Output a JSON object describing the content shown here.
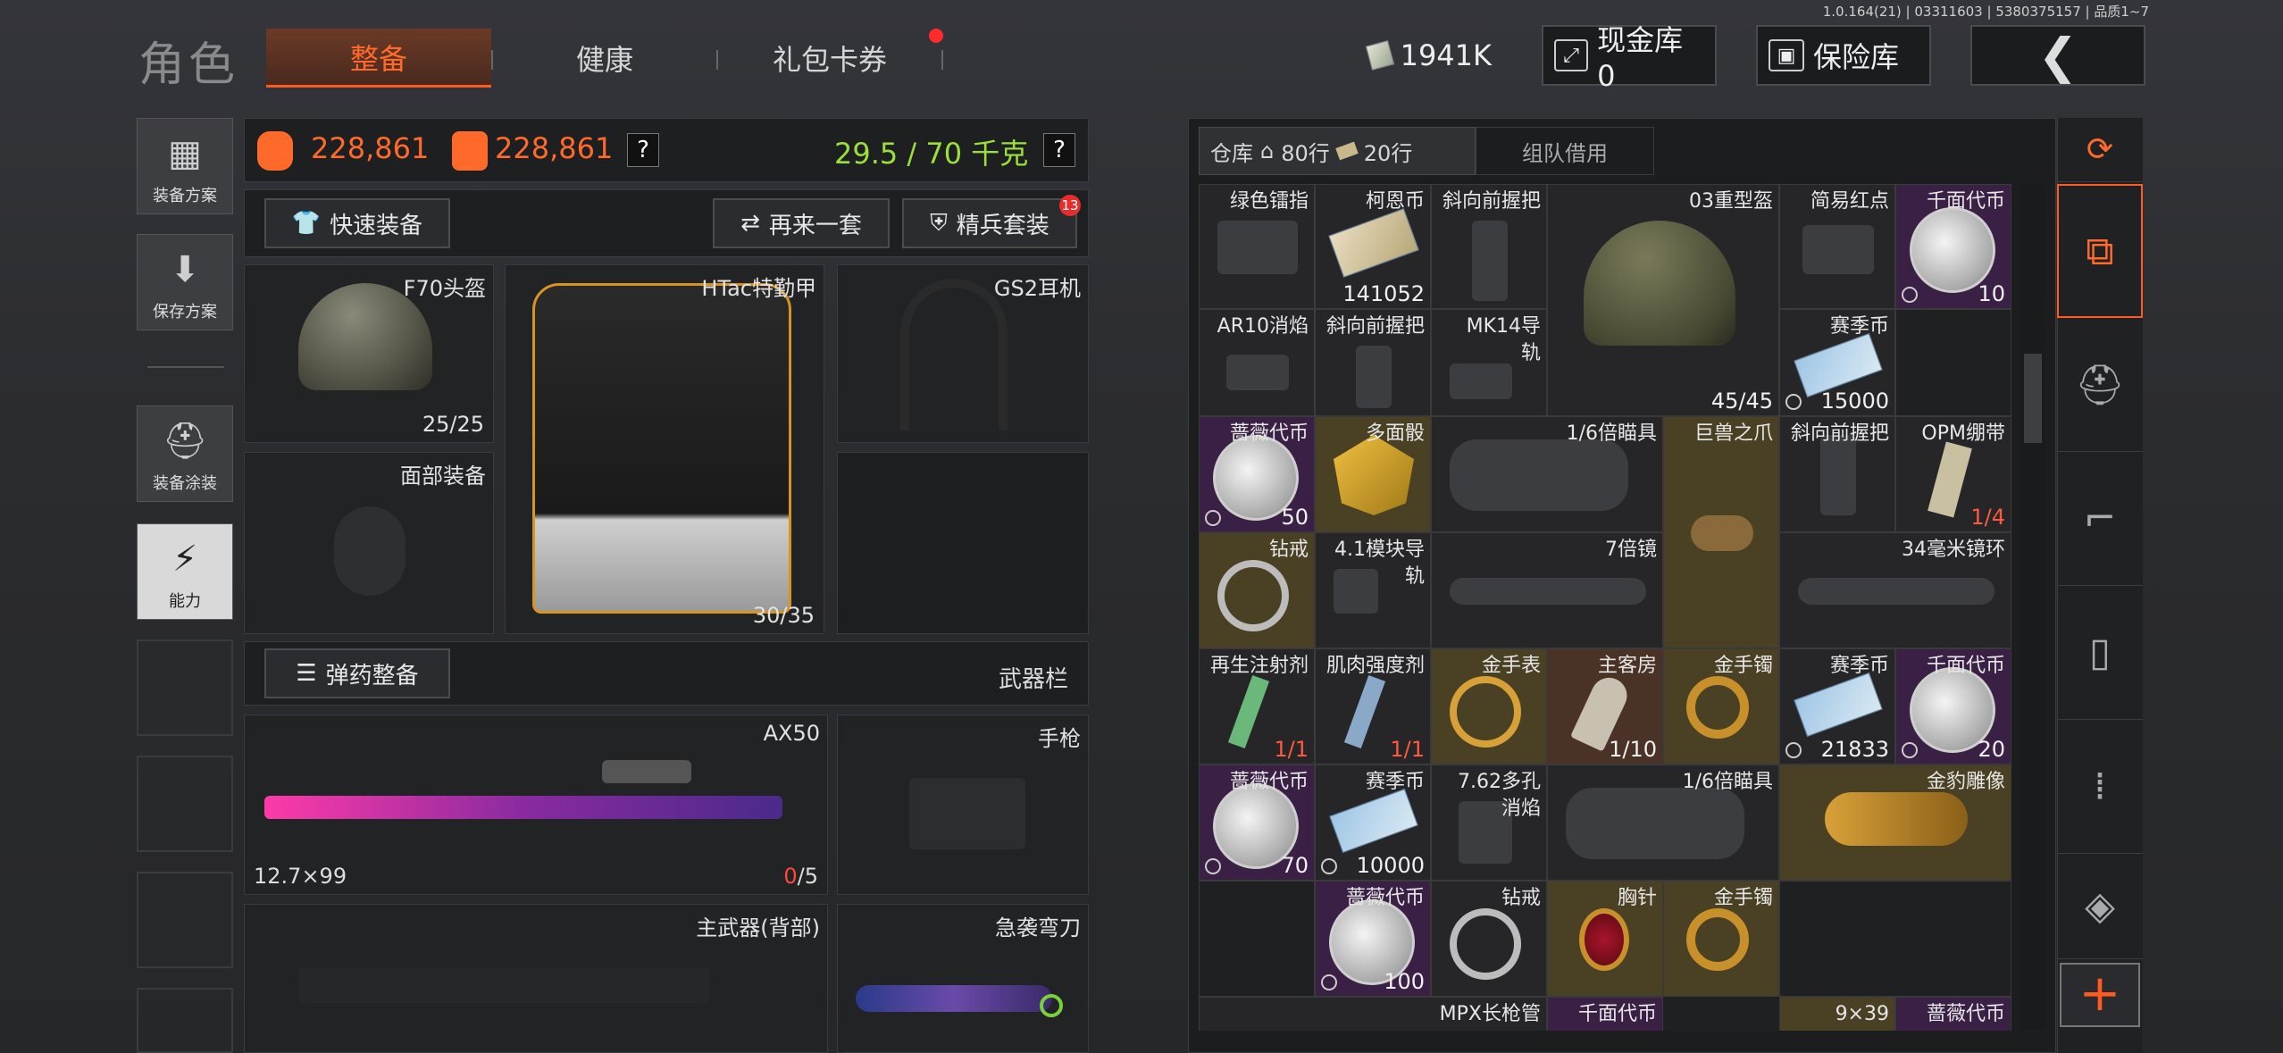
{
  "version": "1.0.164(21) | 03311603 | 5380375157 | 品质1~7",
  "header": {
    "title": "角色",
    "tabs": [
      {
        "label": "整备",
        "active": true
      },
      {
        "label": "健康",
        "active": false
      },
      {
        "label": "礼包卡券",
        "active": false,
        "dot": true
      }
    ],
    "money": "1941K",
    "cash_vault": "现金库 0",
    "safe_box": "保险库"
  },
  "sidebar": [
    {
      "label": "装备方案",
      "icon": "vest-plan-icon"
    },
    {
      "label": "保存方案",
      "icon": "download-icon"
    },
    {
      "label": "装备涂装",
      "icon": "helmet-skin-icon"
    },
    {
      "label": "能力",
      "icon": "ability-icon",
      "selected": true
    }
  ],
  "stats": {
    "value1": "228,861",
    "value2": "228,861",
    "weight": "29.5 / 70 千克",
    "help": "?"
  },
  "actions": {
    "quick_equip": "快速装备",
    "again": "再来一套",
    "elite": "精兵套装",
    "elite_badge": "13",
    "ammo": "弹药整备",
    "weapon_bar": "武器栏"
  },
  "slots": {
    "helmet": {
      "name": "F70头盔",
      "count": "25/25"
    },
    "armor": {
      "name": "HTac特勤甲",
      "count": "30/35"
    },
    "headset": {
      "name": "GS2耳机"
    },
    "face": {
      "name": "面部装备"
    },
    "rifle": {
      "name": "AX50",
      "caliber": "12.7×99",
      "ammo_loaded": "0",
      "ammo_total": "/5"
    },
    "pistol": {
      "name": "手枪"
    },
    "back": {
      "name": "主武器(背部)"
    },
    "melee": {
      "name": "急袭弯刀"
    }
  },
  "storage": {
    "tab_label": "仓库",
    "rows_label": "80行",
    "rows2_label": "20行",
    "team_borrow": "组队借用",
    "items": [
      {
        "name": "绿色镭指",
        "qty": ""
      },
      {
        "name": "柯恩币",
        "qty": "141052"
      },
      {
        "name": "斜向前握把",
        "qty": ""
      },
      {
        "name": "03重型盔",
        "qty": "45/45"
      },
      {
        "name": "简易红点",
        "qty": ""
      },
      {
        "name": "千面代币",
        "qty": "10"
      },
      {
        "name": "AR10消焰",
        "qty": ""
      },
      {
        "name": "斜向前握把",
        "qty": ""
      },
      {
        "name": "MK14导轨",
        "qty": ""
      },
      {
        "name": "赛季币",
        "qty": "15000"
      },
      {
        "name": "蔷薇代币",
        "qty": "50"
      },
      {
        "name": "多面骰",
        "qty": ""
      },
      {
        "name": "1/6倍瞄具",
        "qty": ""
      },
      {
        "name": "巨兽之爪",
        "qty": ""
      },
      {
        "name": "斜向前握把",
        "qty": ""
      },
      {
        "name": "OPM绷带",
        "qty": "1/4"
      },
      {
        "name": "钻戒",
        "qty": ""
      },
      {
        "name": "4.1模块导轨",
        "qty": ""
      },
      {
        "name": "7倍镜",
        "qty": ""
      },
      {
        "name": "34毫米镜环",
        "qty": ""
      },
      {
        "name": "再生注射剂",
        "qty": "1/1"
      },
      {
        "name": "肌肉强度剂",
        "qty": "1/1"
      },
      {
        "name": "金手表",
        "qty": ""
      },
      {
        "name": "主客房",
        "qty": "1/10"
      },
      {
        "name": "金手镯",
        "qty": ""
      },
      {
        "name": "赛季币",
        "qty": "21833"
      },
      {
        "name": "千面代币",
        "qty": "20"
      },
      {
        "name": "蔷薇代币",
        "qty": "70"
      },
      {
        "name": "赛季币",
        "qty": "10000"
      },
      {
        "name": "7.62多孔消焰",
        "qty": ""
      },
      {
        "name": "1/6倍瞄具",
        "qty": ""
      },
      {
        "name": "金豹雕像",
        "qty": ""
      },
      {
        "name": "蔷薇代币",
        "qty": "100"
      },
      {
        "name": "钻戒",
        "qty": ""
      },
      {
        "name": "胸针",
        "qty": ""
      },
      {
        "name": "金手镯",
        "qty": ""
      }
    ],
    "partial_bottom": [
      "MPX长枪管",
      "千面代币",
      "9×39",
      "蔷薇代币"
    ]
  },
  "right_nav": [
    "layers-refresh-icon",
    "layers-icon",
    "helmet-icon",
    "rifle-icon",
    "magazine-icon",
    "bullet-icon",
    "scope-icon",
    "add-icon"
  ],
  "colors": {
    "accent": "#ff5a1f",
    "weight_green": "#9be03a",
    "gold": "#4a4023",
    "purple": "#3a2044"
  }
}
